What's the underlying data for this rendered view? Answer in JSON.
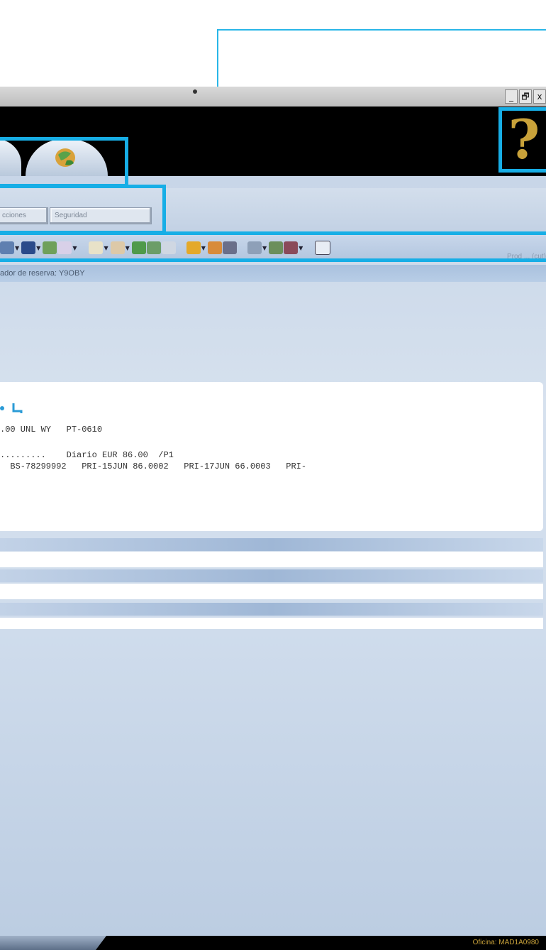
{
  "window": {
    "buttons": [
      "_",
      "🗗",
      "x"
    ]
  },
  "menu": {
    "items": [
      "cciones",
      "Seguridad"
    ]
  },
  "toolbar": {
    "faint_label": "Prod ... (cut)"
  },
  "pnr_bar": {
    "text": "ador de reserva: Y9OBY"
  },
  "panel": {
    "line1": ".00 UNL WY   PT-0610",
    "line2": ".........    Diario EUR 86.00  /P1",
    "line3": "  BS-78299992   PRI-15JUN 86.0002   PRI-17JUN 66.0003   PRI-"
  },
  "status": {
    "office": "Oficina: MAD1A0980"
  },
  "colors": {
    "highlight": "#17aee6",
    "help_icon": "#c9a23a",
    "background": "#cfdcec"
  }
}
